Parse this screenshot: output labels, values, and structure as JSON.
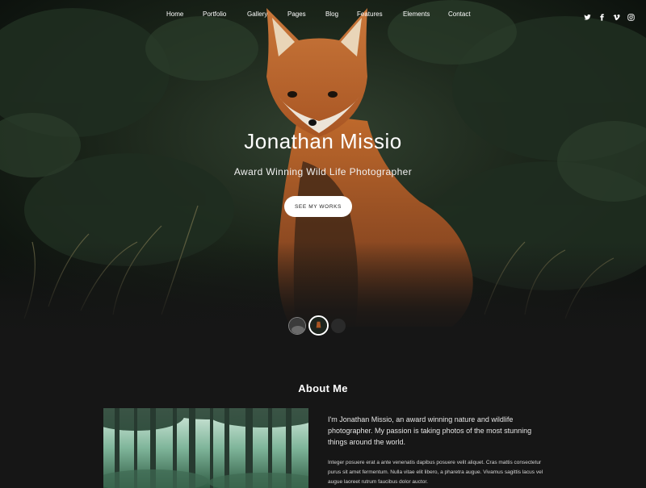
{
  "nav": {
    "items": [
      "Home",
      "Portfolio",
      "Gallery",
      "Pages",
      "Blog",
      "Features",
      "Elements",
      "Contact"
    ],
    "social_icons": [
      "twitter-icon",
      "facebook-icon",
      "vimeo-icon",
      "instagram-icon"
    ]
  },
  "hero": {
    "title": "Jonathan Missio",
    "subtitle": "Award Winning Wild Life Photographer",
    "cta_label": "SEE MY WORKS",
    "slider_count": 3,
    "active_slide": 2
  },
  "about": {
    "title": "About Me",
    "lead": "I'm Jonathan Missio, an award winning nature and wildlife photographer. My passion is taking photos of the most stunning things around the world.",
    "body": "Integer posuere erat a ante venenatis dapibus posuere velit aliquet. Cras mattis consectetur purus sit amet fermentum. Nulla vitae elit libero, a pharetra augue. Vivamus sagittis lacus vel augue laoreet rutrum faucibus dolor auctor."
  },
  "colors": {
    "background": "#161616",
    "hero_dark": "#0f1411",
    "fox": "#b8622b",
    "text": "#ffffff",
    "button_bg": "#ffffff",
    "button_text": "#222222"
  }
}
